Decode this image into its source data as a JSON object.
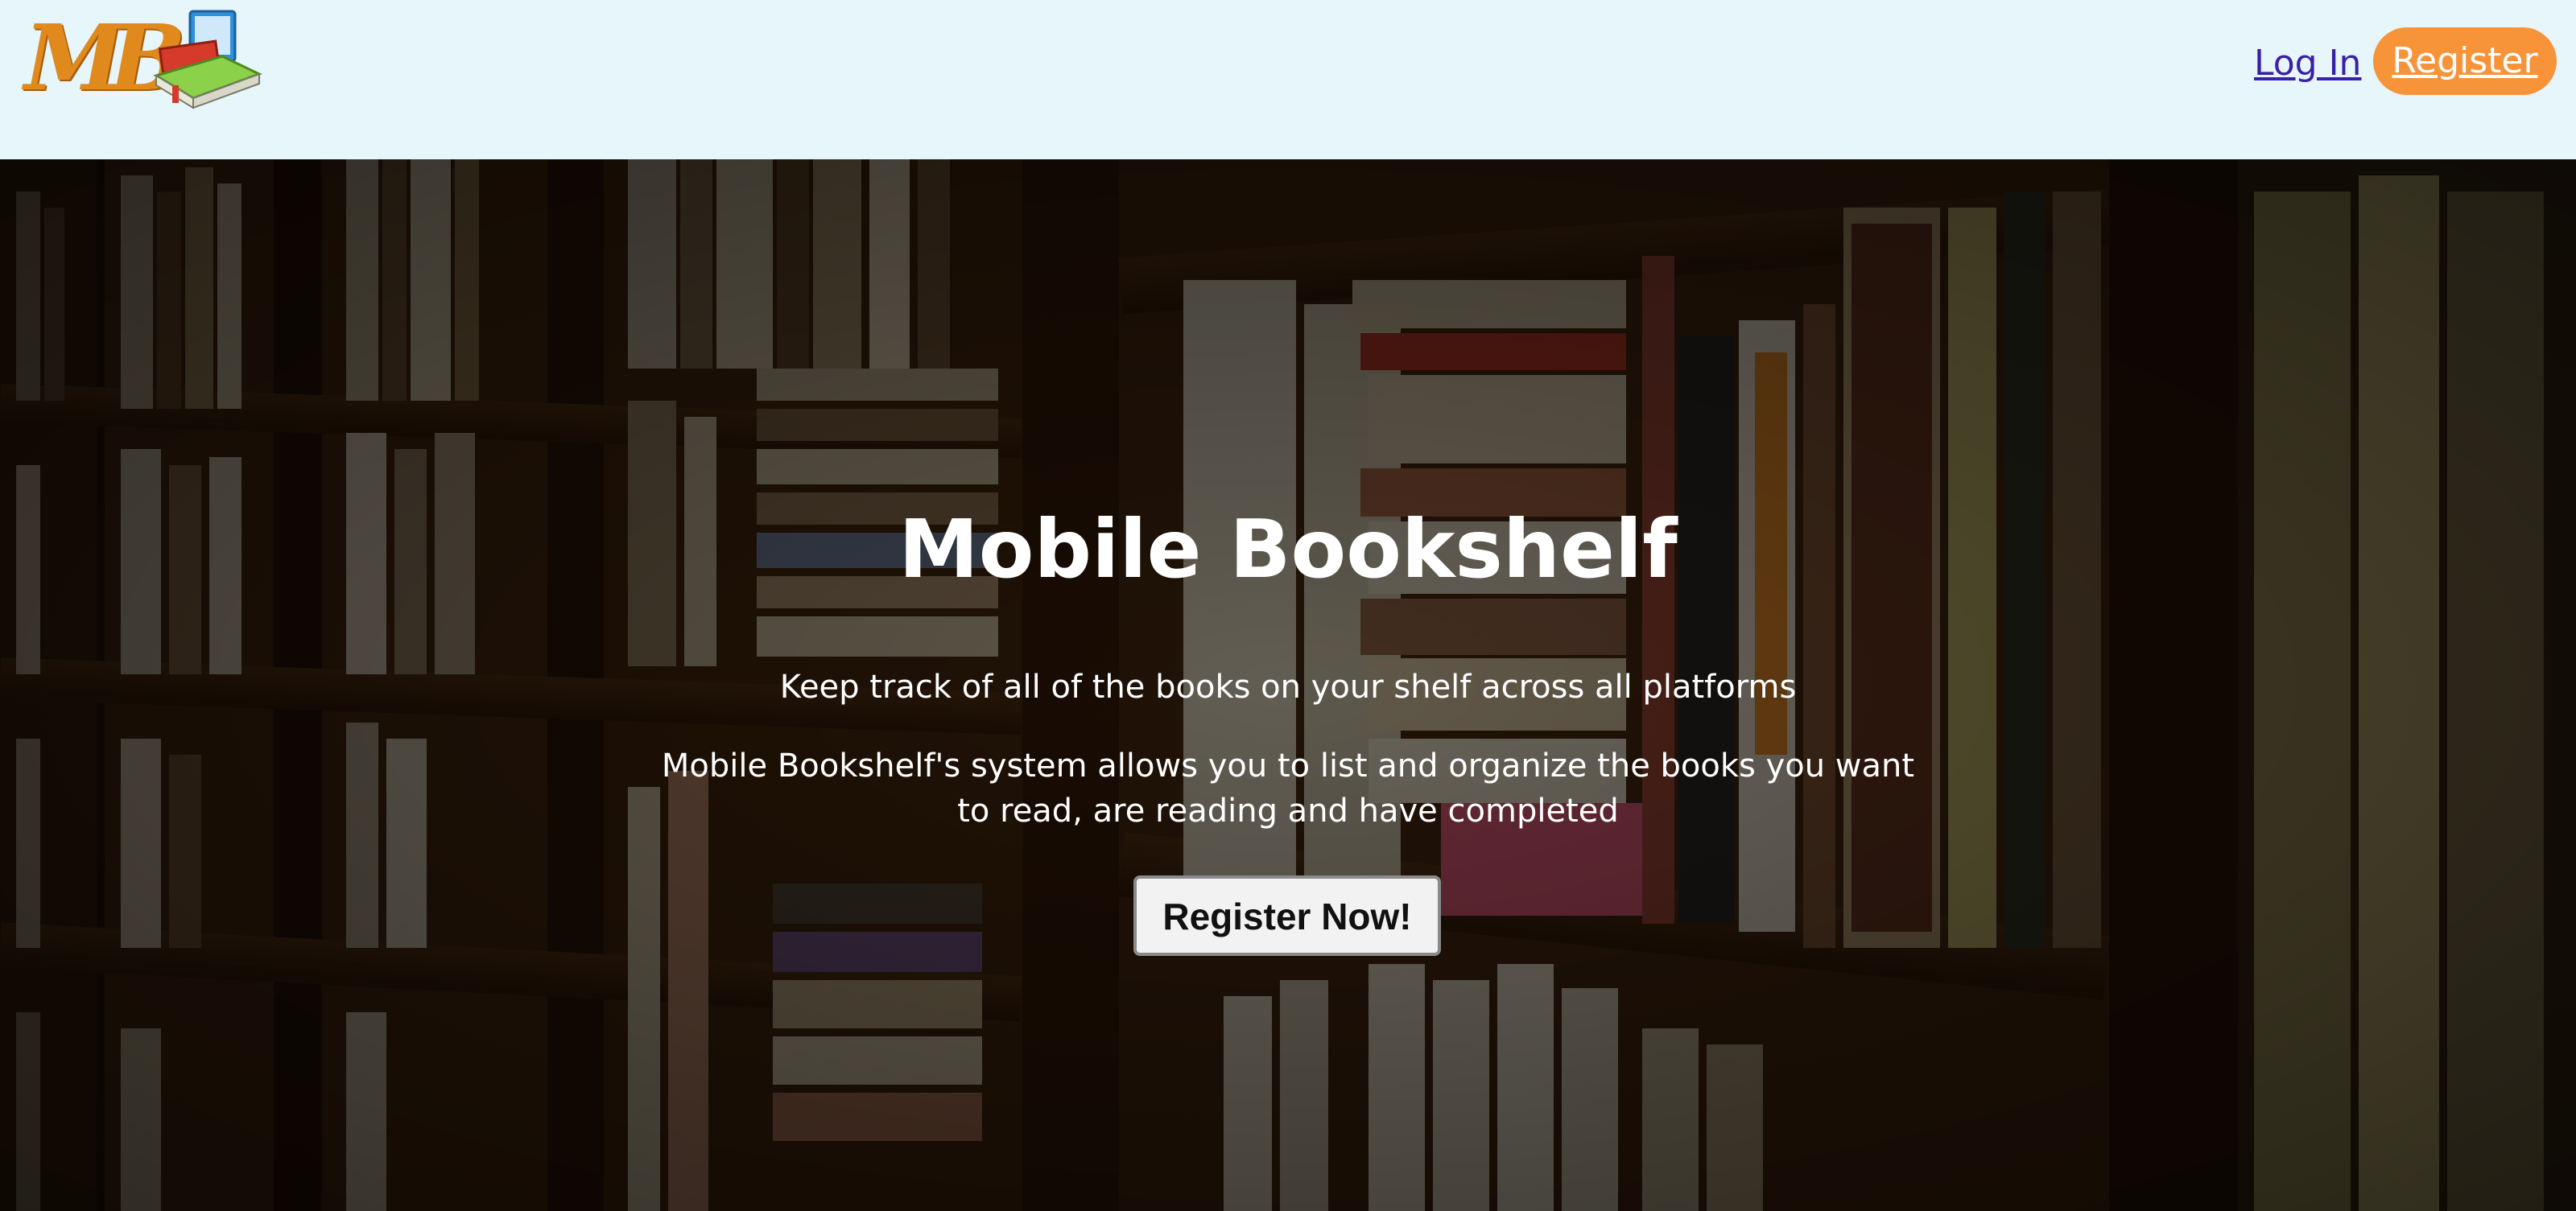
{
  "header": {
    "logo_text": "MB",
    "login_label": "Log In",
    "register_label": "Register"
  },
  "hero": {
    "title": "Mobile Bookshelf",
    "tagline": "Keep track of all of the books on your shelf across all platforms",
    "description": "Mobile Bookshelf's system allows you to list and organize the books you want to read, are reading and have completed",
    "cta_label": "Register Now!"
  },
  "colors": {
    "header_bg": "#e6f6fa",
    "accent_orange": "#f7943a",
    "link_purple": "#3b1fa8",
    "hero_text": "#ffffff"
  },
  "icons": {
    "logo": "books-logo-icon"
  }
}
